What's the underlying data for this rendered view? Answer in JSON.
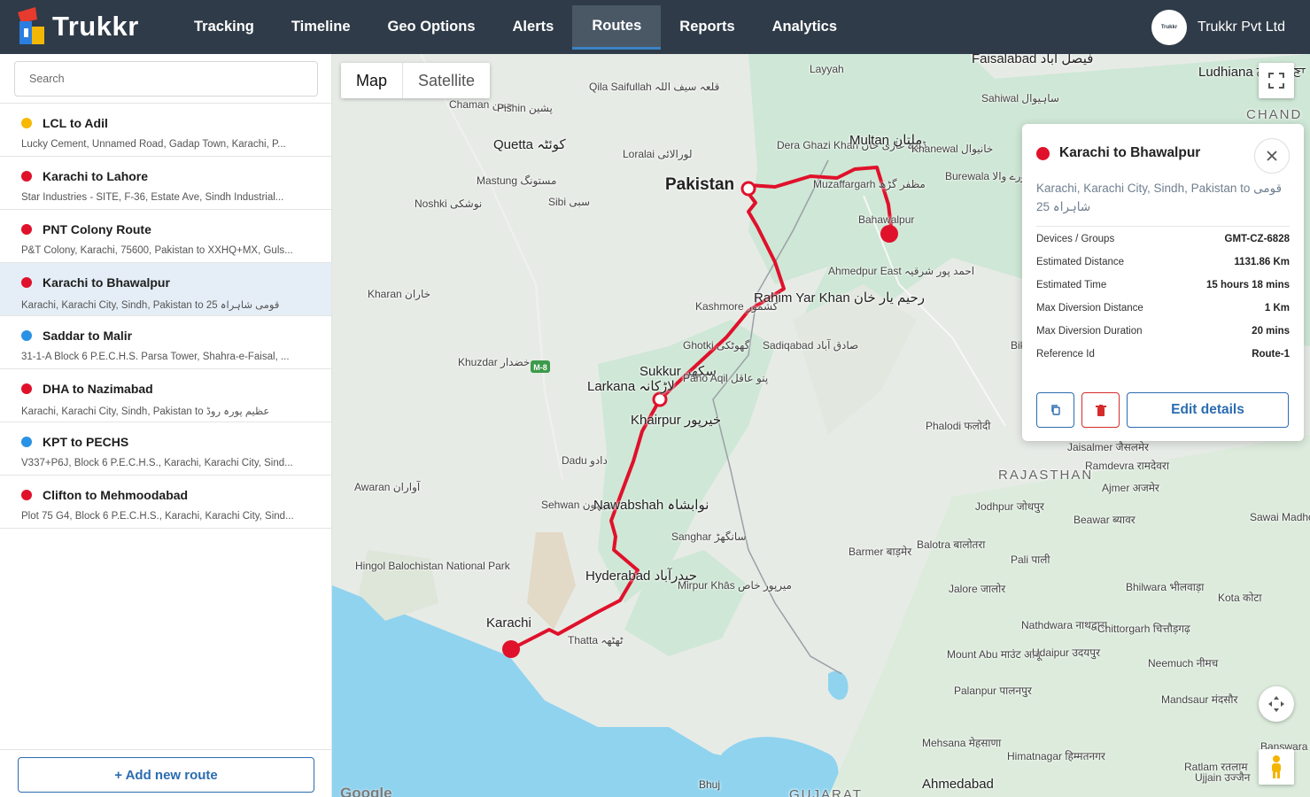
{
  "app": {
    "brand": "Trukkr",
    "company_name": "Trukkr Pvt Ltd",
    "company_avatar_text": "Trukkr"
  },
  "nav": {
    "items": [
      "Tracking",
      "Timeline",
      "Geo Options",
      "Alerts",
      "Routes",
      "Reports",
      "Analytics"
    ],
    "active": "Routes"
  },
  "sidebar": {
    "search_placeholder": "Search",
    "routes": [
      {
        "title": "LCL to Adil",
        "subtitle": "Lucky Cement, Unnamed Road, Gadap Town, Karachi, P...",
        "color": "#f6b800"
      },
      {
        "title": "Karachi to Lahore",
        "subtitle": "Star Industries - SITE, F-36, Estate Ave, Sindh Industrial...",
        "color": "#e0112b"
      },
      {
        "title": "PNT Colony Route",
        "subtitle": "P&T Colony, Karachi, 75600, Pakistan to XXHQ+MX, Guls...",
        "color": "#e0112b"
      },
      {
        "title": "Karachi to Bhawalpur",
        "subtitle": "Karachi, Karachi City, Sindh, Pakistan to قومی شاہراہ 25",
        "color": "#e0112b",
        "selected": true
      },
      {
        "title": "Saddar to Malir",
        "subtitle": "31-1-A Block 6 P.E.C.H.S. Parsa Tower, Shahra-e-Faisal, ...",
        "color": "#2a92e4"
      },
      {
        "title": "DHA to Nazimabad",
        "subtitle": "Karachi, Karachi City, Sindh, Pakistan to عظیم پورہ روڈ",
        "color": "#e0112b"
      },
      {
        "title": "KPT to PECHS",
        "subtitle": "V337+P6J, Block 6 P.E.C.H.S., Karachi, Karachi City, Sind...",
        "color": "#2a92e4"
      },
      {
        "title": "Clifton to Mehmoodabad",
        "subtitle": "Plot 75 G4, Block 6 P.E.C.H.S., Karachi, Karachi City, Sind...",
        "color": "#e0112b"
      }
    ],
    "add_button": "+ Add new route"
  },
  "map": {
    "type_buttons": [
      "Map",
      "Satellite"
    ],
    "active_type": "Map",
    "route_color": "#e0112b",
    "labels": [
      "Faisalabad فیصل آباد",
      "Ludhiana ਲੁਧਿਆਣਾ",
      "Layyah",
      "Qila Saifullah قلعہ سیف اللہ",
      "Chaman چمن",
      "Pishin پشین",
      "Sahiwal ساہیوال",
      "CHAND",
      "Quetta کوئٹہ",
      "Dera Ghazi Khan ڈیرہ غازی خان",
      "Multan ملتان",
      "Khanewal خانیوال",
      "Loralai لورالائی",
      "Mastung مستونگ",
      "Pakistan",
      "Muzaffargarh مظفر گڑھ",
      "Burewala بورے والا",
      "Noshki نوشکی",
      "Sibi سبی",
      "Bahawalpur",
      "Kharan خاران",
      "Ahmedpur East احمد پور شرقیہ",
      "Kashmore کشمور",
      "Rahim Yar Khan رحیم یار خان",
      "Ghotki گھوٹکی",
      "Sadiqabad صادق آباد",
      "Bika बीका",
      "Khuzdar خضدار",
      "Sukkur سکھر",
      "Larkana لاڑکانہ",
      "Pano Aqil پنو عاقل",
      "Khairpur خیرپور",
      "Phalodi फलोदी",
      "Jaisalmer जैसलमेर",
      "Ramdevra रामदेवरा",
      "Dadu دادو",
      "RAJASTHAN",
      "Ajmer अजमेर",
      "Awaran آواران",
      "Sehwan سیہون",
      "Nawabshah نوابشاہ",
      "Jodhpur जोधपुर",
      "Beawar ब्यावर",
      "Sanghar سانگھڑ",
      "Sawai Madhopur सवाई माधोपुर",
      "Hingol Balochistan National Park",
      "Barmer बाड़मेर",
      "Balotra बालोतरा",
      "Pali पाली",
      "Hyderabad حیدرآباد",
      "Mirpur Khās میرپور خاص",
      "Jalore जालोर",
      "Bhilwara भीलवाड़ा",
      "Kota कोटा",
      "Karachi",
      "Thatta ٹھٹھہ",
      "Nathdwara नाथद्वारा",
      "Chittorgarh चित्तौड़गढ़",
      "Mount Abu माउंट आबू",
      "Udaipur उदयपुर",
      "Neemuch नीमच",
      "Palanpur पालनपुर",
      "Mandsaur मंदसौर",
      "Mehsana मेहसाणा",
      "Banswara बांसवाड़ा",
      "Himatnagar हिम्मतनगर",
      "Ratlam रतलाम",
      "Bhuj",
      "Ahmedabad",
      "Ujjain उज्जैन",
      "GUJARAT",
      "M-8",
      "Google"
    ]
  },
  "panel": {
    "title": "Karachi to Bhawalpur",
    "color": "#e0112b",
    "description": "Karachi, Karachi City, Sindh, Pakistan to قومی شاہراہ 25",
    "details": [
      {
        "label": "Devices / Groups",
        "value": "GMT-CZ-6828"
      },
      {
        "label": "Estimated Distance",
        "value": "1131.86 Km"
      },
      {
        "label": "Estimated Time",
        "value": "15 hours 18 mins"
      },
      {
        "label": "Max Diversion Distance",
        "value": "1 Km"
      },
      {
        "label": "Max Diversion Duration",
        "value": "20 mins"
      },
      {
        "label": "Reference Id",
        "value": "Route-1"
      }
    ],
    "edit_button": "Edit details"
  }
}
